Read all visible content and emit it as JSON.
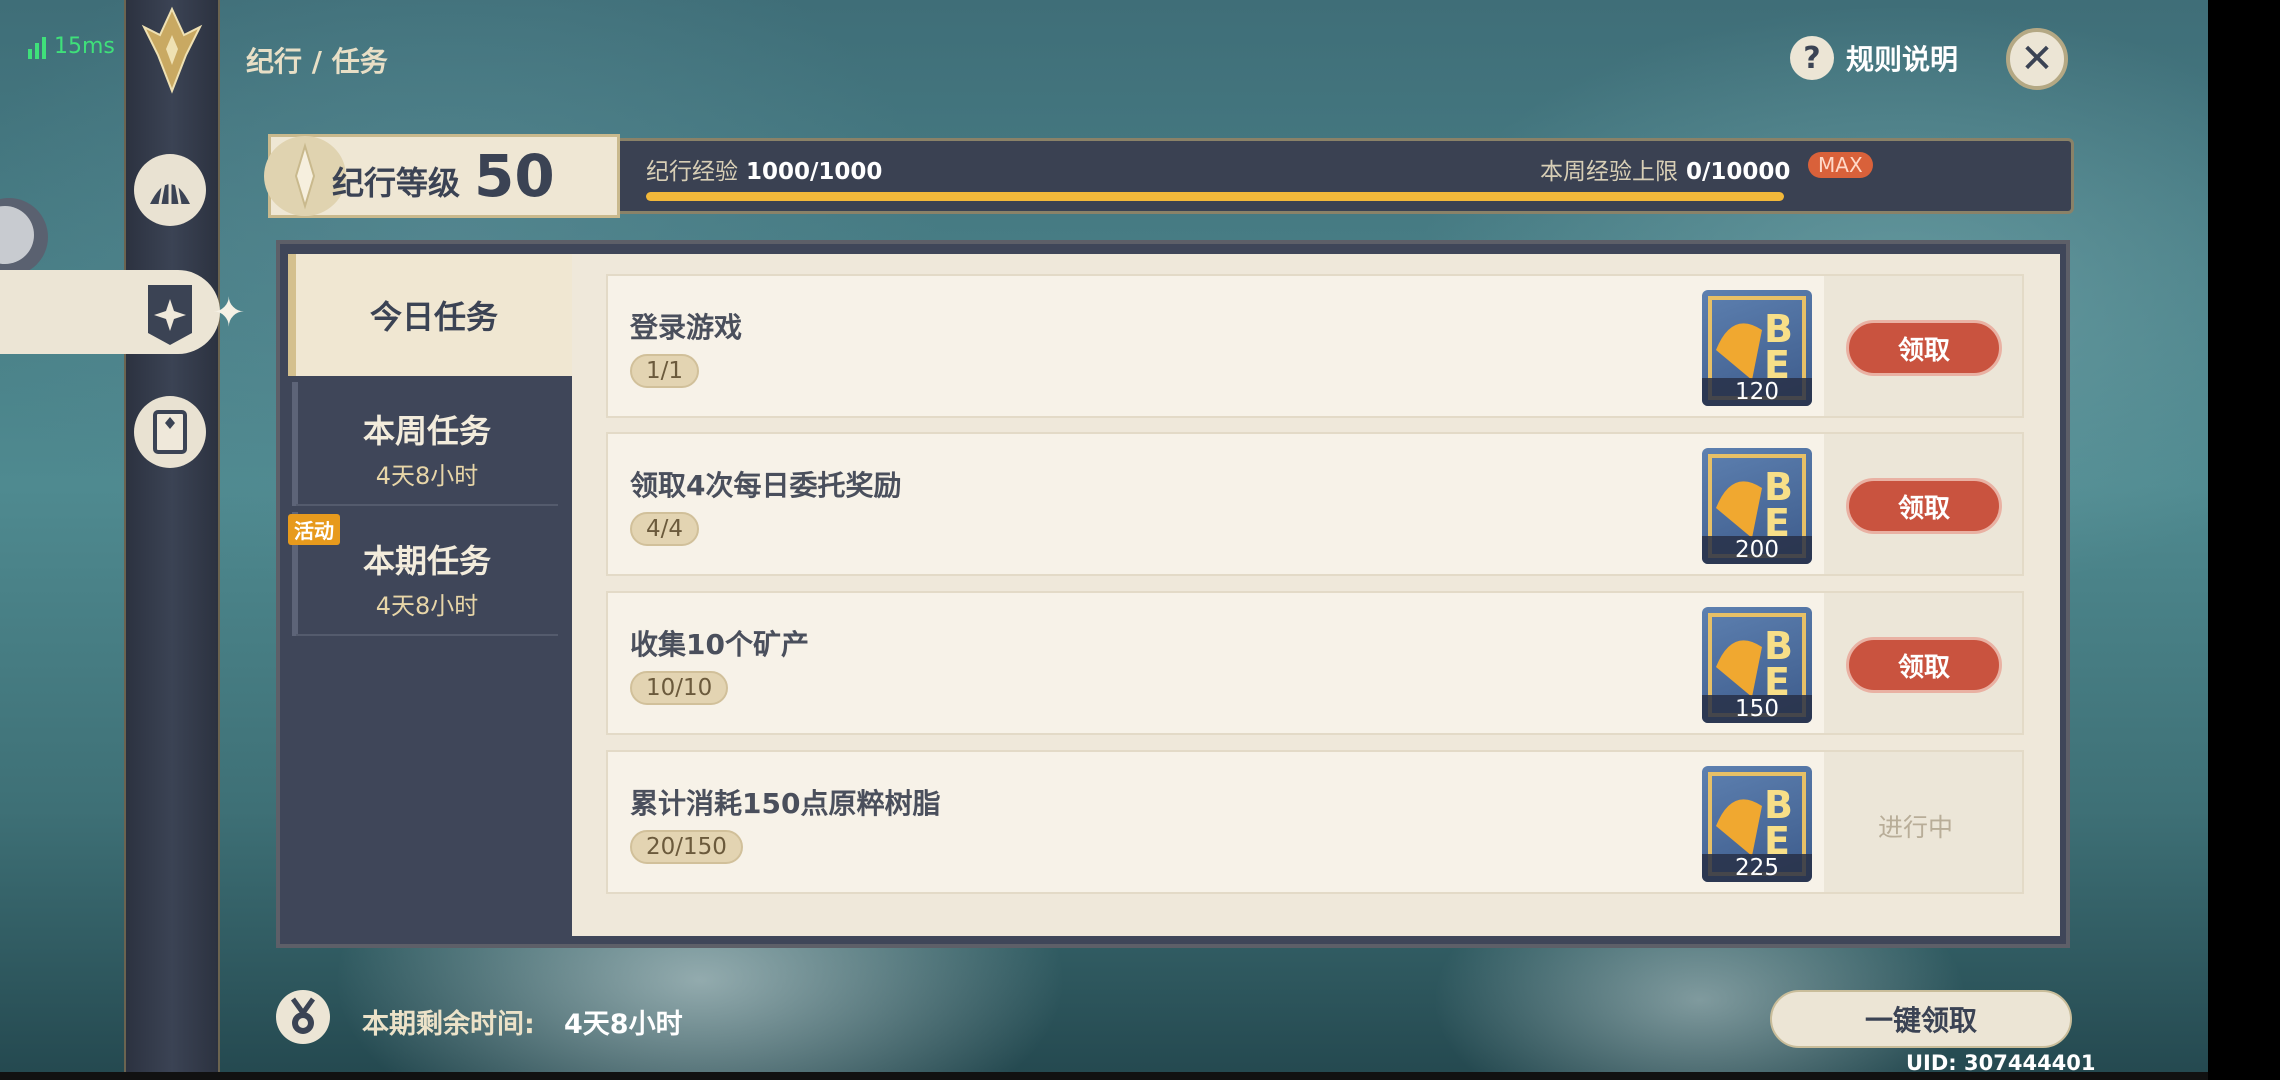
{
  "ping": "15ms",
  "breadcrumb": "纪行 / 任务",
  "header": {
    "rules_label": "规则说明",
    "rules_icon": "?",
    "close_icon": "✕"
  },
  "level": {
    "label": "纪行等级",
    "value": "50",
    "exp_label": "纪行经验",
    "exp_value": "1000/1000",
    "exp_progress": 1.0,
    "weekly_label": "本周经验上限",
    "weekly_value": "0/10000",
    "max_badge": "MAX"
  },
  "tabs": [
    {
      "name": "今日任务",
      "time": ""
    },
    {
      "name": "本周任务",
      "time": "4天8小时"
    },
    {
      "name": "本期任务",
      "time": "4天8小时",
      "badge": "活动"
    }
  ],
  "tasks": [
    {
      "name": "登录游戏",
      "progress": "1/1",
      "reward": "120",
      "action": "领取"
    },
    {
      "name": "领取4次每日委托奖励",
      "progress": "4/4",
      "reward": "200",
      "action": "领取"
    },
    {
      "name": "收集10个矿产",
      "progress": "10/10",
      "reward": "150",
      "action": "领取"
    },
    {
      "name": "累计消耗150点原粹树脂",
      "progress": "20/150",
      "reward": "225",
      "action": "进行中"
    }
  ],
  "footer": {
    "remaining_label": "本期剩余时间:",
    "remaining_time": "4天8小时",
    "claim_all": "一键领取",
    "uid": "UID: 307444401"
  },
  "colors": {
    "accent_gold": "#f2b83a",
    "claim_red": "#c9533f",
    "max_orange": "#d9613a",
    "panel_dark": "#3f4659"
  }
}
